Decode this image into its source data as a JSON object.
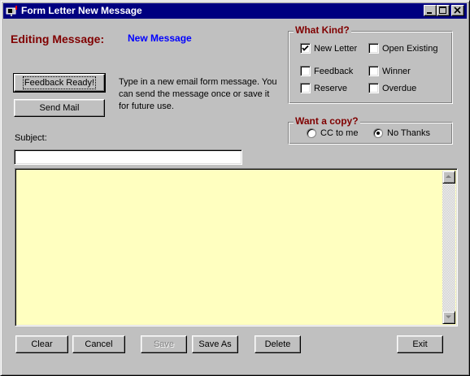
{
  "window": {
    "title": "Form Letter New Message",
    "icon": "mailbox-icon"
  },
  "header": {
    "editing_label": "Editing Message:",
    "message_name": "New Message"
  },
  "actions": {
    "feedback_ready": "Feedback Ready!",
    "send_mail": "Send Mail"
  },
  "help_text": "Type in a new email form message. You can send the message once or save it for future use.",
  "what_kind": {
    "title": "What Kind?",
    "options": [
      {
        "label": "New Letter",
        "checked": true
      },
      {
        "label": "Open Existing",
        "checked": false
      },
      {
        "label": "Feedback",
        "checked": false
      },
      {
        "label": "Winner",
        "checked": false
      },
      {
        "label": "Reserve",
        "checked": false
      },
      {
        "label": "Overdue",
        "checked": false
      }
    ]
  },
  "copy": {
    "title": "Want a copy?",
    "options": [
      {
        "label": "CC to me",
        "selected": false
      },
      {
        "label": "No Thanks",
        "selected": true
      }
    ]
  },
  "subject": {
    "label": "Subject:",
    "value": ""
  },
  "message_body": {
    "value": "",
    "background": "#ffffc0"
  },
  "footer": {
    "clear": "Clear",
    "cancel": "Cancel",
    "save": "Save",
    "save_as": "Save As",
    "delete": "Delete",
    "exit": "Exit"
  },
  "colors": {
    "titlebar": "#000080",
    "label_accent": "#800000",
    "message_name": "#0000ff"
  }
}
